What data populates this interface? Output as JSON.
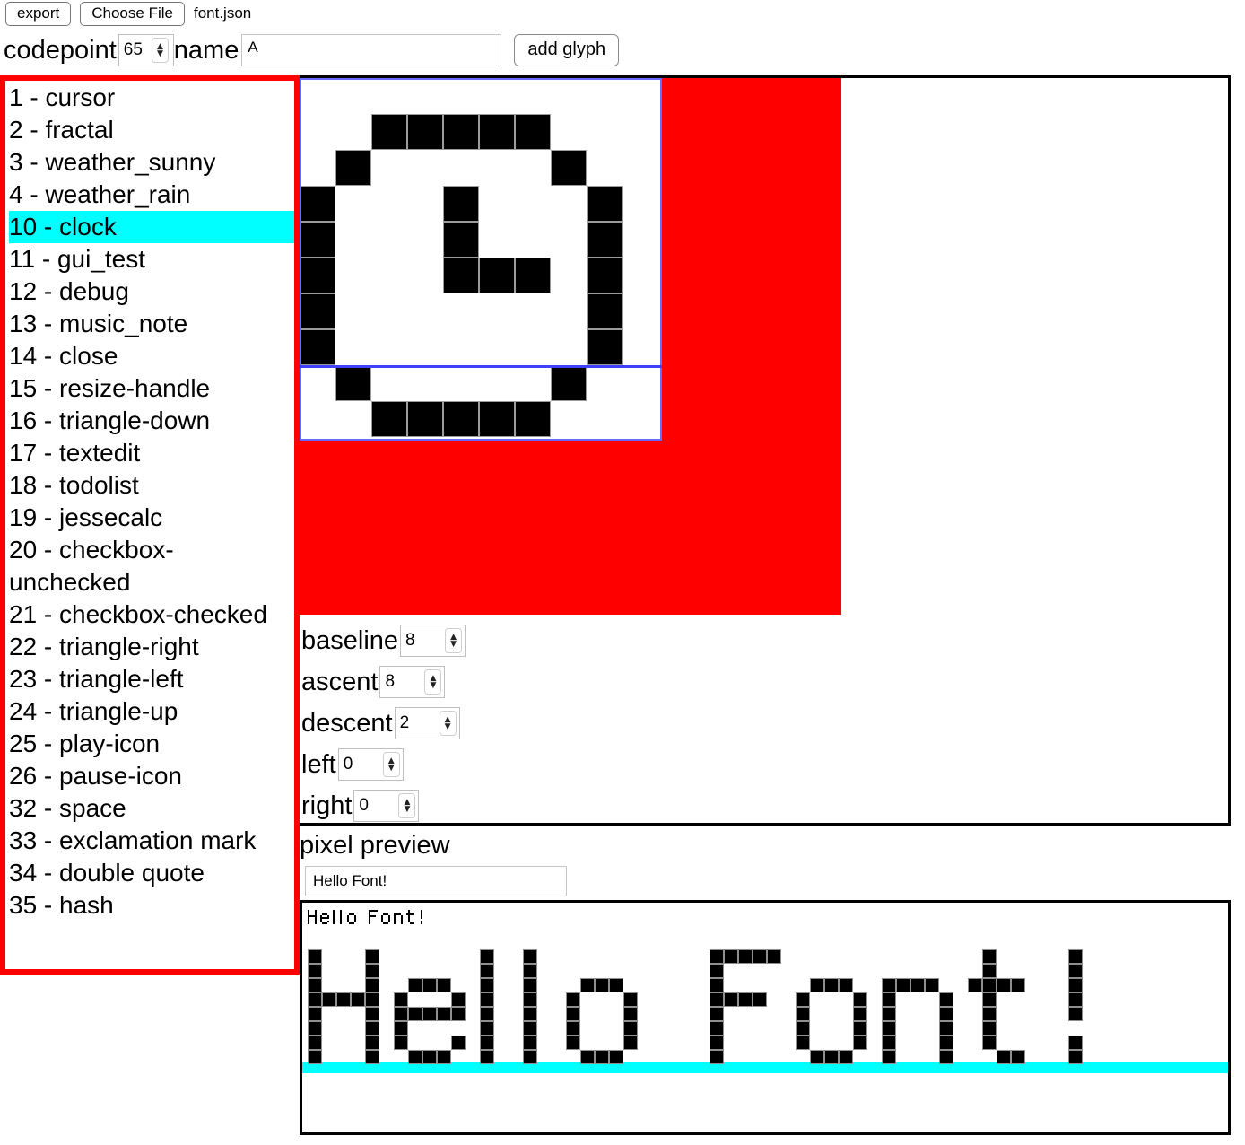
{
  "toolbar": {
    "export_label": "export",
    "choose_file_label": "Choose File",
    "filename": "font.json"
  },
  "meta": {
    "codepoint_label": "codepoint",
    "codepoint_value": "65",
    "name_label": "name",
    "name_value": "A",
    "add_glyph_label": "add glyph"
  },
  "glyph_list": {
    "selected_index": 4,
    "items": [
      "1 - cursor",
      "2 - fractal",
      "3 - weather_sunny",
      "4 - weather_rain",
      "10 - clock",
      "11 - gui_test",
      "12 - debug",
      "13 - music_note",
      "14 - close",
      "15 - resize-handle",
      "16 - triangle-down",
      "17 - textedit",
      "18 - todolist",
      "19 - jessecalc",
      "20 - checkbox-unchecked",
      "21 - checkbox-checked",
      "22 - triangle-right",
      "23 - triangle-left",
      "24 - triangle-up",
      "25 - play-icon",
      "26 - pause-icon",
      "32 - space",
      "33 - exclamation mark",
      "34 - double quote",
      "35 - hash"
    ]
  },
  "editor": {
    "grid_cols": 10,
    "grid_rows": 10,
    "canvas_bg_color": "#ff0000",
    "cell_on_color": "#000000",
    "cell_off_color": "#ffffff",
    "metric_line_color": "#4040ff",
    "pixels": [
      [
        0,
        0,
        0,
        0,
        0,
        0,
        0,
        0,
        0,
        0
      ],
      [
        0,
        0,
        1,
        1,
        1,
        1,
        1,
        0,
        0,
        0
      ],
      [
        0,
        1,
        0,
        0,
        0,
        0,
        0,
        1,
        0,
        0
      ],
      [
        1,
        0,
        0,
        0,
        1,
        0,
        0,
        0,
        1,
        0
      ],
      [
        1,
        0,
        0,
        0,
        1,
        0,
        0,
        0,
        1,
        0
      ],
      [
        1,
        0,
        0,
        0,
        1,
        1,
        1,
        0,
        1,
        0
      ],
      [
        1,
        0,
        0,
        0,
        0,
        0,
        0,
        0,
        1,
        0
      ],
      [
        1,
        0,
        0,
        0,
        0,
        0,
        0,
        0,
        1,
        0
      ],
      [
        0,
        1,
        0,
        0,
        0,
        0,
        0,
        1,
        0,
        0
      ],
      [
        0,
        0,
        1,
        1,
        1,
        1,
        1,
        0,
        0,
        0
      ]
    ],
    "metrics": [
      {
        "label": "baseline",
        "value": "8"
      },
      {
        "label": "ascent",
        "value": "8"
      },
      {
        "label": "descent",
        "value": "2"
      },
      {
        "label": "left",
        "value": "0"
      },
      {
        "label": "right",
        "value": "0"
      }
    ]
  },
  "preview": {
    "label": "pixel preview",
    "text_value": "Hello Font!",
    "baseline_color": "#00ffff",
    "glyphs": {
      "H": [
        [
          1,
          0,
          0,
          0,
          1
        ],
        [
          1,
          0,
          0,
          0,
          1
        ],
        [
          1,
          0,
          0,
          0,
          1
        ],
        [
          1,
          1,
          1,
          1,
          1
        ],
        [
          1,
          0,
          0,
          0,
          1
        ],
        [
          1,
          0,
          0,
          0,
          1
        ],
        [
          1,
          0,
          0,
          0,
          1
        ],
        [
          1,
          0,
          0,
          0,
          1
        ]
      ],
      "e": [
        [
          0,
          0,
          0,
          0,
          0
        ],
        [
          0,
          0,
          0,
          0,
          0
        ],
        [
          0,
          1,
          1,
          1,
          0
        ],
        [
          1,
          0,
          0,
          0,
          1
        ],
        [
          1,
          1,
          1,
          1,
          1
        ],
        [
          1,
          0,
          0,
          0,
          0
        ],
        [
          1,
          0,
          0,
          0,
          1
        ],
        [
          0,
          1,
          1,
          1,
          0
        ]
      ],
      "l": [
        [
          1,
          0
        ],
        [
          1,
          0
        ],
        [
          1,
          0
        ],
        [
          1,
          0
        ],
        [
          1,
          0
        ],
        [
          1,
          0
        ],
        [
          1,
          0
        ],
        [
          1,
          0
        ]
      ],
      "o": [
        [
          0,
          0,
          0,
          0,
          0
        ],
        [
          0,
          0,
          0,
          0,
          0
        ],
        [
          0,
          1,
          1,
          1,
          0
        ],
        [
          1,
          0,
          0,
          0,
          1
        ],
        [
          1,
          0,
          0,
          0,
          1
        ],
        [
          1,
          0,
          0,
          0,
          1
        ],
        [
          1,
          0,
          0,
          0,
          1
        ],
        [
          0,
          1,
          1,
          1,
          0
        ]
      ],
      "F": [
        [
          1,
          1,
          1,
          1,
          1
        ],
        [
          1,
          0,
          0,
          0,
          0
        ],
        [
          1,
          0,
          0,
          0,
          0
        ],
        [
          1,
          1,
          1,
          1,
          0
        ],
        [
          1,
          0,
          0,
          0,
          0
        ],
        [
          1,
          0,
          0,
          0,
          0
        ],
        [
          1,
          0,
          0,
          0,
          0
        ],
        [
          1,
          0,
          0,
          0,
          0
        ]
      ],
      "n": [
        [
          0,
          0,
          0,
          0,
          0
        ],
        [
          0,
          0,
          0,
          0,
          0
        ],
        [
          1,
          1,
          1,
          1,
          0
        ],
        [
          1,
          0,
          0,
          0,
          1
        ],
        [
          1,
          0,
          0,
          0,
          1
        ],
        [
          1,
          0,
          0,
          0,
          1
        ],
        [
          1,
          0,
          0,
          0,
          1
        ],
        [
          1,
          0,
          0,
          0,
          1
        ]
      ],
      "t": [
        [
          0,
          1,
          0,
          0,
          0
        ],
        [
          0,
          1,
          0,
          0,
          0
        ],
        [
          1,
          1,
          1,
          1,
          0
        ],
        [
          0,
          1,
          0,
          0,
          0
        ],
        [
          0,
          1,
          0,
          0,
          0
        ],
        [
          0,
          1,
          0,
          0,
          0
        ],
        [
          0,
          1,
          0,
          0,
          0
        ],
        [
          0,
          0,
          1,
          1,
          0
        ]
      ],
      "!": [
        [
          0,
          1,
          0
        ],
        [
          0,
          1,
          0
        ],
        [
          0,
          1,
          0
        ],
        [
          0,
          1,
          0
        ],
        [
          0,
          1,
          0
        ],
        [
          0,
          0,
          0
        ],
        [
          0,
          1,
          0
        ],
        [
          0,
          1,
          0
        ]
      ],
      " ": [
        [
          0,
          0,
          0
        ],
        [
          0,
          0,
          0
        ],
        [
          0,
          0,
          0
        ],
        [
          0,
          0,
          0
        ],
        [
          0,
          0,
          0
        ],
        [
          0,
          0,
          0
        ],
        [
          0,
          0,
          0
        ],
        [
          0,
          0,
          0
        ]
      ]
    }
  }
}
